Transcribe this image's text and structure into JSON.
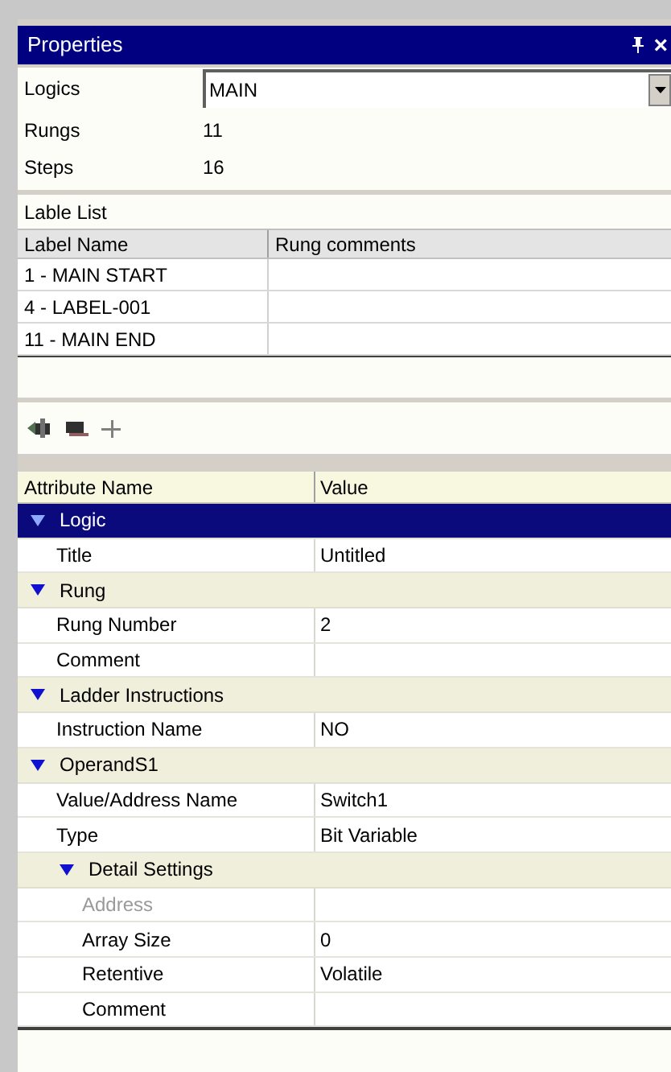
{
  "window": {
    "title": "Properties",
    "buttons": [
      "×"
    ]
  },
  "logics": {
    "label": "Logics",
    "value": "MAIN"
  },
  "info": [
    {
      "label": "Rungs",
      "value": "11"
    },
    {
      "label": "Steps",
      "value": "16"
    }
  ],
  "label_list": {
    "title": "Lable List",
    "columns": [
      "Label Name",
      "Rung comments"
    ],
    "rows": [
      {
        "label_name": "1 - MAIN START"
      },
      {
        "label_name": "4 - LABEL-001"
      },
      {
        "label_name": "11 - MAIN END"
      }
    ]
  },
  "attributes": {
    "columns": [
      "Attribute Name",
      "Value"
    ],
    "items": [
      {
        "kind": "category",
        "name": "Logic",
        "expanded": true,
        "selected": true,
        "children": [
          {
            "kind": "property",
            "name": "Title",
            "value": "Untitled",
            "disabled": false
          }
        ]
      },
      {
        "kind": "category",
        "name": "Rung",
        "expanded": true,
        "selected": false,
        "children": [
          {
            "kind": "property",
            "name": "Rung Number",
            "value": "2",
            "disabled": false
          },
          {
            "kind": "property",
            "name": "Comment",
            "disabled": false
          }
        ]
      },
      {
        "kind": "category",
        "name": "Ladder Instructions",
        "expanded": true,
        "selected": false,
        "children": [
          {
            "kind": "property",
            "name": "Instruction Name",
            "value": "NO",
            "disabled": false
          }
        ]
      },
      {
        "kind": "category",
        "name": "OperandS1",
        "expanded": true,
        "selected": false,
        "children": [
          {
            "kind": "property",
            "name": "Value/Address Name",
            "value": "Switch1",
            "disabled": false
          },
          {
            "kind": "property",
            "name": "Type",
            "value": "Bit Variable",
            "disabled": false
          },
          {
            "kind": "category",
            "name": "Detail Settings",
            "expanded": true,
            "selected": false,
            "children": [
              {
                "kind": "property",
                "name": "Address",
                "disabled": true
              },
              {
                "kind": "property",
                "name": "Array Size",
                "value": "0",
                "disabled": false
              },
              {
                "kind": "property",
                "name": "Retentive",
                "value": "Volatile",
                "disabled": false
              },
              {
                "kind": "property",
                "name": "Comment",
                "disabled": false
              }
            ]
          }
        ]
      }
    ]
  }
}
